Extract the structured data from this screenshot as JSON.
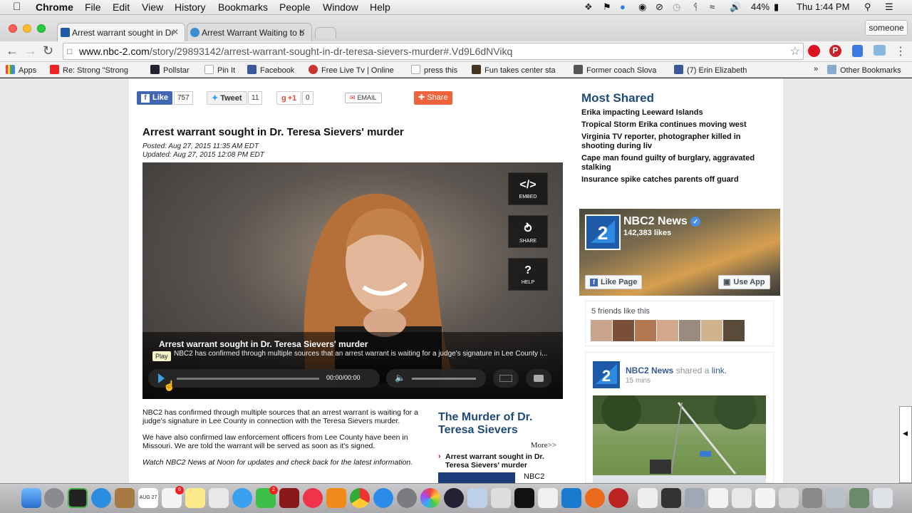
{
  "menubar": {
    "apple": "",
    "app": "Chrome",
    "items": [
      "File",
      "Edit",
      "View",
      "History",
      "Bookmarks",
      "People",
      "Window",
      "Help"
    ],
    "battery": "44%",
    "clock": "Thu 1:44 PM"
  },
  "tabs": [
    {
      "title": "Arrest warrant sought in Dr",
      "active": true
    },
    {
      "title": "Arrest Warrant Waiting to b",
      "active": false
    }
  ],
  "profile": "someone",
  "url": {
    "host": "www.nbc-2.com",
    "path": "/story/29893142/arrest-warrant-sought-in-dr-teresa-sievers-murder#.Vd9L6dNVikq"
  },
  "bookmarks": [
    "Apps",
    "Re: Strong \"Strong",
    "Pollstar",
    "Pin It",
    "Facebook",
    "Free Live Tv | Online",
    "press this",
    "Fun takes center sta",
    "Former coach Slova",
    "(7) Erin Elizabeth"
  ],
  "other_bookmarks": "Other Bookmarks",
  "share": {
    "like": "Like",
    "like_count": "757",
    "tweet": "Tweet",
    "tweet_count": "11",
    "gplus": "+1",
    "gplus_count": "0",
    "email": "EMAIL",
    "share": "Share"
  },
  "article": {
    "headline": "Arrest warrant sought in Dr. Teresa Sievers' murder",
    "posted": "Posted: Aug 27, 2015 11:35 AM EDT",
    "updated": "Updated: Aug 27, 2015 12:08 PM EDT",
    "paragraphs": [
      "NBC2 has confirmed through multiple sources that an arrest warrant is waiting for a judge's signature in Lee County in connection with the Teresa Sievers murder.",
      "We have also confirmed law enforcement officers from Lee County have been in Missouri. We are told the warrant will be served as soon as it's signed.",
      "Watch NBC2 News at Noon for updates and check back for the latest information."
    ]
  },
  "video": {
    "embed": "EMBED",
    "share": "SHARE",
    "help": "HELP",
    "caption_title": "Arrest warrant sought in Dr. Teresa Sievers' murder",
    "caption_desc": "NBC2 has confirmed through multiple sources that an arrest warrant is waiting for a judge's signature in Lee County i...",
    "tooltip": "Play",
    "time": "00:00/00:00",
    "progress": 0
  },
  "murder_box": {
    "title": "The Murder of Dr. Teresa Sievers",
    "more": "More>>",
    "link": "Arrest warrant sought in Dr. Teresa Sievers' murder",
    "thumb_label": "NBC2"
  },
  "most_shared": {
    "title": "Most Shared",
    "items": [
      "Erika impacting Leeward Islands",
      "Tropical Storm Erika continues moving west",
      "Virginia TV reporter, photographer killed in shooting during liv",
      "Cape man found guilty of burglary, aggravated stalking",
      "Insurance spike catches parents off guard"
    ]
  },
  "fb": {
    "name": "NBC2 News",
    "likes": "142,383 likes",
    "like_page": "Like Page",
    "use_app": "Use App",
    "friends": "5 friends like this",
    "post_name": "NBC2 News",
    "post_action": "shared a",
    "post_link": "link.",
    "post_time": "15 mins"
  },
  "colors": {
    "accent": "#1e4a7a",
    "fb": "#3b5998",
    "share": "#f0643c"
  },
  "dock_badges": {
    "calendar": "AUG 27",
    "reminders": "6",
    "messages": "2"
  }
}
